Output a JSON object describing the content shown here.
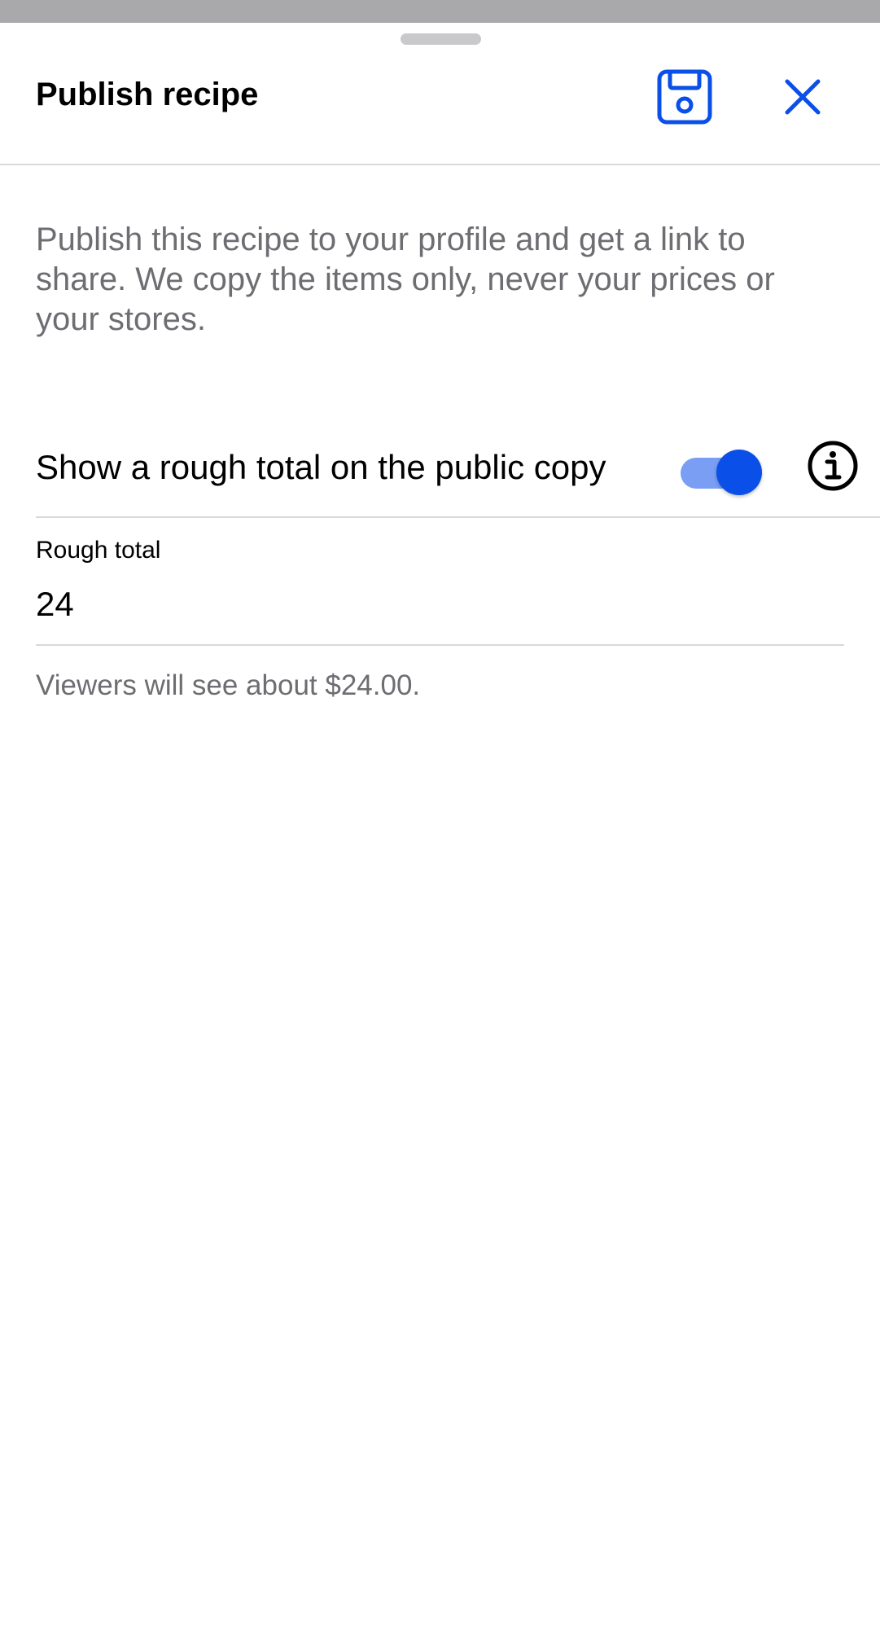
{
  "header": {
    "title": "Publish recipe",
    "save_icon": "save-icon",
    "close_icon": "close-icon"
  },
  "description": "Publish this recipe to your profile and get a link to share. We copy the items only, never your prices or your stores.",
  "setting": {
    "label": "Show a rough total on the public copy",
    "toggle_on": true,
    "info_icon": "info-icon"
  },
  "rough_total": {
    "label": "Rough total",
    "value": "24"
  },
  "helper_text": "Viewers will see about $24.00.",
  "colors": {
    "accent": "#0a4fe8",
    "toggle_track": "#7a9ef4",
    "secondary_text": "#6d6d72",
    "divider": "#d9d9dc",
    "backdrop": "#a9a9ab"
  }
}
